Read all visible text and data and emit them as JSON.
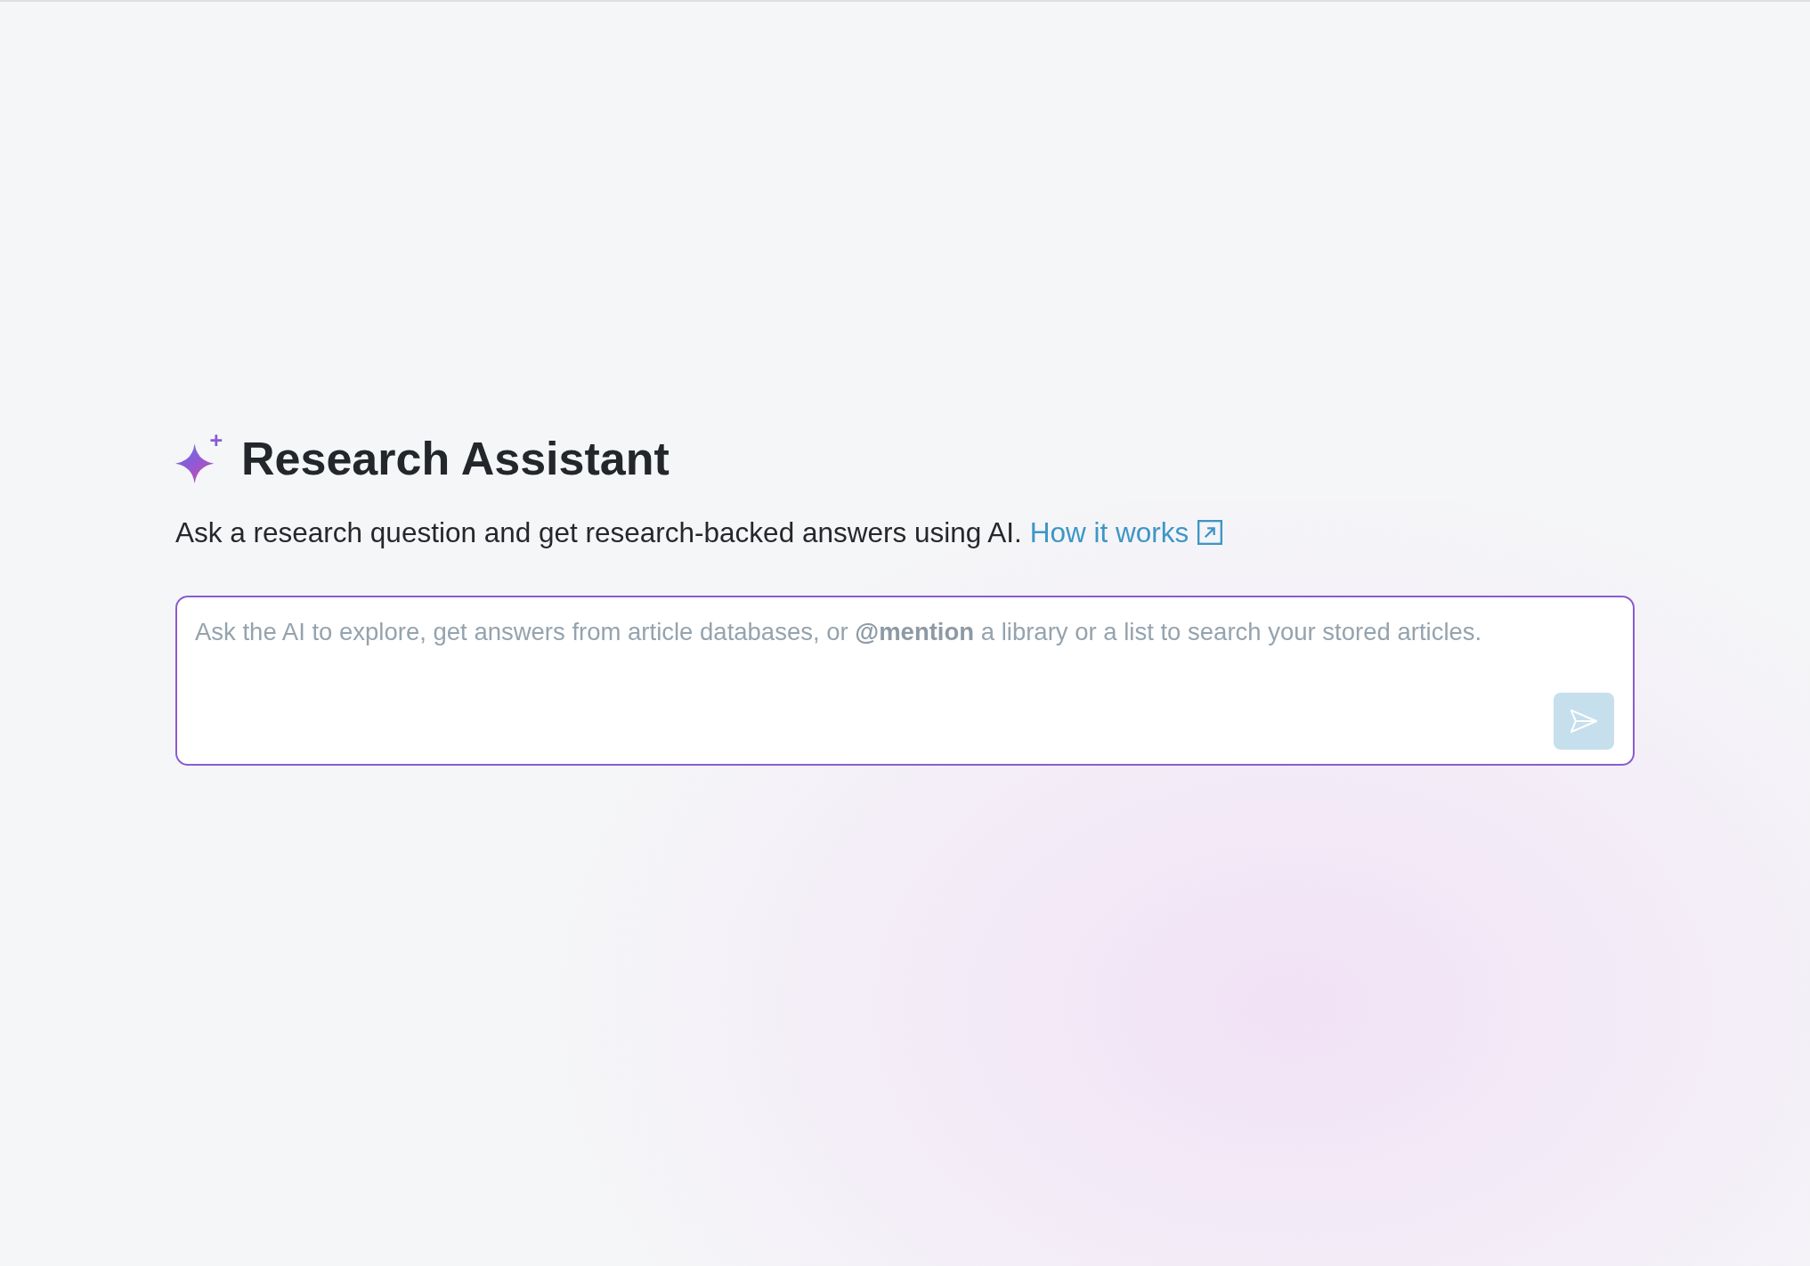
{
  "header": {
    "title": "Research Assistant",
    "subtitle": "Ask a research question and get research-backed answers using AI.",
    "link": {
      "label": "How it works"
    }
  },
  "prompt": {
    "placeholder": "Ask the AI to explore, get answers from article databases, or **@mention** a library or a list to search your stored articles.",
    "send_button": {
      "disabled": true
    }
  }
}
